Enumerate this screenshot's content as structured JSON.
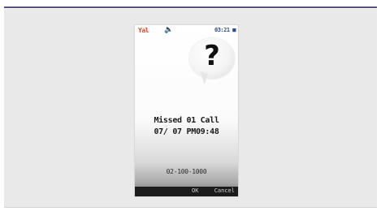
{
  "status": {
    "signal_text": "Yal",
    "speaker_icon": "speaker-icon",
    "battery_text": "03:21 ■"
  },
  "alert": {
    "icon": "question-mark-bubble",
    "question_mark": "?",
    "title": "Missed 01 Call",
    "datetime": "07/ 07  PM09:48",
    "phone_number": "02-100-1000"
  },
  "softkeys": {
    "ok_label": "OK",
    "cancel_label": "Cancel"
  },
  "colors": {
    "frame_rule": "#5a4f86",
    "panel_bg": "#e9e9e9",
    "softbar_bg": "#1c1c1c"
  }
}
